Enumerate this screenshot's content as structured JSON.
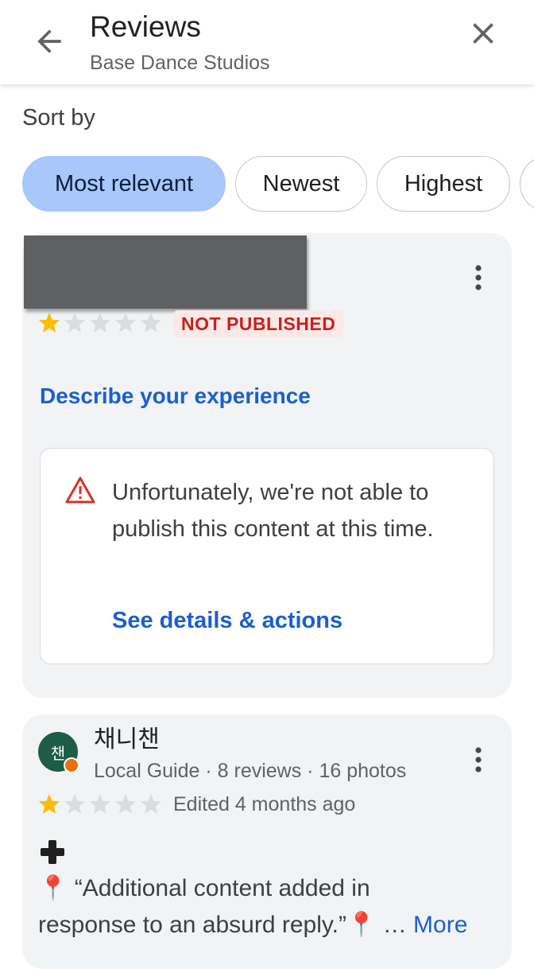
{
  "header": {
    "title": "Reviews",
    "subtitle": "Base Dance Studios",
    "back_icon": "arrow-back-icon",
    "close_icon": "close-icon"
  },
  "sort": {
    "label": "Sort by",
    "chips": [
      {
        "label": "Most relevant",
        "selected": true
      },
      {
        "label": "Newest",
        "selected": false
      },
      {
        "label": "Highest",
        "selected": false
      }
    ]
  },
  "own_review": {
    "rating": 1,
    "max_rating": 5,
    "status_badge": "NOT PUBLISHED",
    "describe_link": "Describe your experience",
    "warning": {
      "text": "Unfortunately, we're not able to publish this content at this time.",
      "link": "See details & actions"
    }
  },
  "review": {
    "avatar_initial": "챈",
    "author": "채니챈",
    "meta": "Local Guide · 8 reviews · 16 photos",
    "rating": 1,
    "max_rating": 5,
    "edited": "Edited 4 months ago",
    "text_line1": "“Additional content added in",
    "text_line2": "response to an absurd reply.”",
    "ellipsis": "…",
    "more": "More"
  },
  "colors": {
    "accent": "#1a5fcf",
    "chip_selected": "#a8c7fa",
    "star_filled": "#fbbc04",
    "star_empty": "#dadce0",
    "warning": "#d93025"
  }
}
